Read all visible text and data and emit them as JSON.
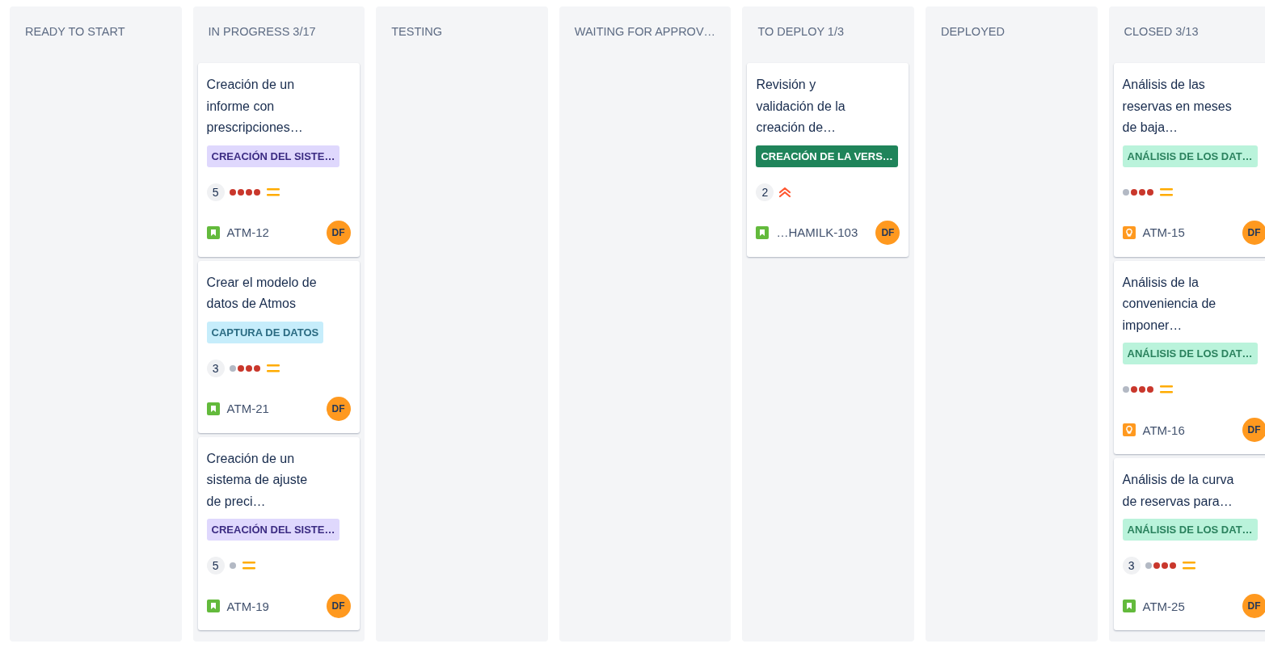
{
  "columns": [
    {
      "title": "READY TO START"
    },
    {
      "title": "IN PROGRESS 3/17",
      "cards": [
        {
          "summary": "Creación de un informe con prescripciones…",
          "label": {
            "text": "CREACIÓN DEL SISTE…",
            "color": "#dfd8fd"
          },
          "estimate": "5",
          "dots": [
            {
              "filled": true
            },
            {
              "filled": true
            },
            {
              "filled": true
            },
            {
              "filled": true
            }
          ],
          "priority": {
            "kind": "medium"
          },
          "issue_type": {
            "kind": "story"
          },
          "key": "ATM-12",
          "assignee": "DF"
        },
        {
          "summary": "Crear el modelo de datos de Atmos",
          "label": {
            "text": "CAPTURA DE DATOS",
            "color": "#c6edfb"
          },
          "estimate": "3",
          "dots": [
            {
              "filled": false
            },
            {
              "filled": true
            },
            {
              "filled": true
            },
            {
              "filled": true
            }
          ],
          "priority": {
            "kind": "medium"
          },
          "issue_type": {
            "kind": "story"
          },
          "key": "ATM-21",
          "assignee": "DF"
        },
        {
          "summary": "Creación de un sistema de ajuste de preci…",
          "label": {
            "text": "CREACIÓN DEL SISTE…",
            "color": "#dfd8fd"
          },
          "estimate": "5",
          "dots": [
            {
              "filled": false
            }
          ],
          "priority": {
            "kind": "medium"
          },
          "issue_type": {
            "kind": "story"
          },
          "key": "ATM-19",
          "assignee": "DF"
        }
      ]
    },
    {
      "title": "TESTING"
    },
    {
      "title": "WAITING FOR APPROV…"
    },
    {
      "title": "TO DEPLOY 1/3",
      "cards": [
        {
          "summary": "Revisión y validación de la creación de…",
          "label": {
            "text": "CREACIÓN DE LA VERS…",
            "color": "#1f845a"
          },
          "estimate": "2",
          "priority": {
            "kind": "highest"
          },
          "issue_type": {
            "kind": "story"
          },
          "key": "…HAMILK-103",
          "assignee": "DF"
        }
      ]
    },
    {
      "title": "DEPLOYED"
    },
    {
      "title": "CLOSED 3/13",
      "cards": [
        {
          "summary": "Análisis de las reservas en meses de baja…",
          "label": {
            "text": "ANÁLISIS DE LOS DAT…",
            "color": "#baf3db"
          },
          "dots": [
            {
              "filled": false
            },
            {
              "filled": true
            },
            {
              "filled": true
            },
            {
              "filled": true
            }
          ],
          "priority": {
            "kind": "medium"
          },
          "issue_type": {
            "kind": "idea"
          },
          "key": "ATM-15",
          "assignee": "DF"
        },
        {
          "summary": "Análisis de la conveniencia de imponer…",
          "label": {
            "text": "ANÁLISIS DE LOS DAT…",
            "color": "#baf3db"
          },
          "dots": [
            {
              "filled": false
            },
            {
              "filled": true
            },
            {
              "filled": true
            },
            {
              "filled": true
            }
          ],
          "priority": {
            "kind": "medium"
          },
          "issue_type": {
            "kind": "idea"
          },
          "key": "ATM-16",
          "assignee": "DF"
        },
        {
          "summary": "Análisis de la curva de reservas para…",
          "label": {
            "text": "ANÁLISIS DE LOS DAT…",
            "color": "#baf3db"
          },
          "estimate": "3",
          "dots": [
            {
              "filled": false
            },
            {
              "filled": true
            },
            {
              "filled": true
            },
            {
              "filled": true
            }
          ],
          "priority": {
            "kind": "medium"
          },
          "issue_type": {
            "kind": "story"
          },
          "key": "ATM-25",
          "assignee": "DF"
        }
      ]
    }
  ]
}
